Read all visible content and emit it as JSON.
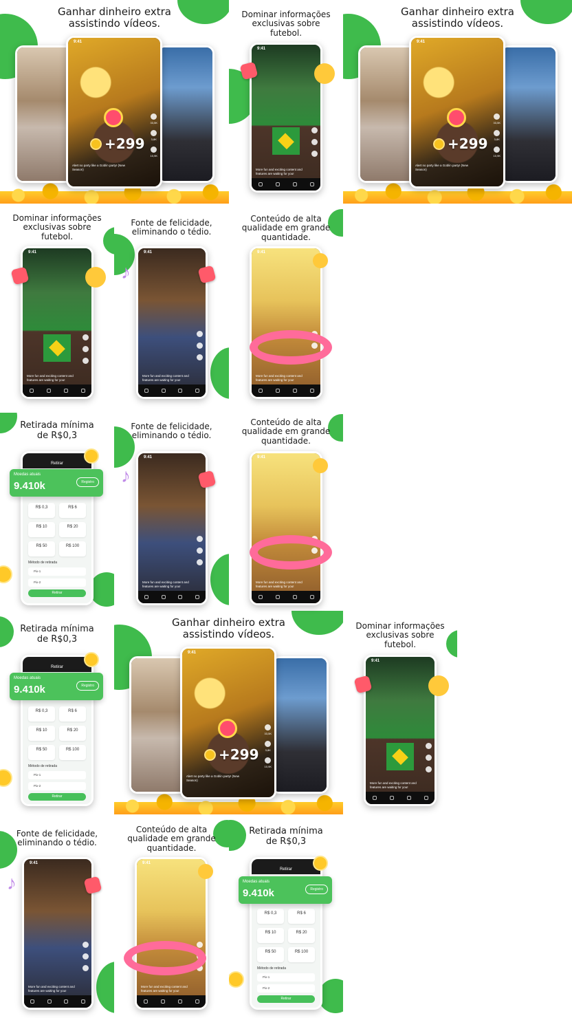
{
  "captions": {
    "earn": "Ganhar dinheiro extra assistindo vídeos.",
    "football": "Dominar informações exclusivas sobre futebol.",
    "happiness": "Fonte de felicidade, eliminando o tédio.",
    "quality": "Conteúdo de alta qualidade em grande quantidade.",
    "withdraw": "Retirada mínima de R$0,3"
  },
  "status_time": "9:41",
  "reward": {
    "amount": "+299"
  },
  "feed": {
    "clip_text": "Alert no party like a Goblin party! (New Season)",
    "source": "Source : JPNEWS",
    "clip_text_alt": "More fun and exciting content and features are waiting for you!",
    "likes": "33,5K",
    "comments": "3,8K",
    "shares": "10,9K",
    "nav": [
      "Short video",
      "Recommend",
      "Earn",
      "Mine"
    ]
  },
  "withdraw": {
    "title": "Retirar",
    "balance_label": "Moedas atuais",
    "balance_value": "9.410k",
    "balance_note": "≈ R$0.941",
    "record_button": "Registro",
    "section_label": "Selecione o valor",
    "options": [
      "R$ 0,3",
      "R$ 6",
      "R$ 10",
      "R$ 20",
      "R$ 50",
      "R$ 100"
    ],
    "method_label": "Método de retirada",
    "methods": [
      "Pix-1",
      "Pix-2"
    ],
    "submit": "Retirar"
  },
  "colors": {
    "brand_green": "#3fbb4c",
    "gold": "#f7c21f",
    "heart": "#ff5a6a"
  }
}
